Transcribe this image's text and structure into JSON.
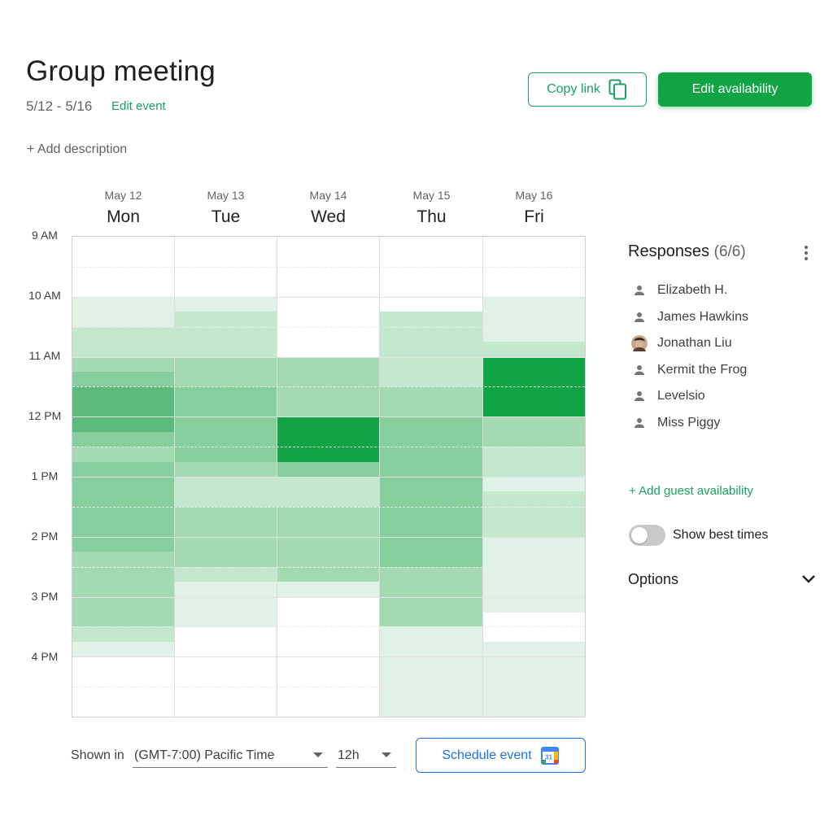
{
  "event": {
    "title": "Group meeting",
    "dates": "5/12 - 5/16",
    "edit_event": "Edit event",
    "add_description": "+ Add description"
  },
  "toolbar": {
    "copy_link": "Copy link",
    "edit_availability": "Edit availability"
  },
  "days": [
    {
      "date": "May 12",
      "dow": "Mon"
    },
    {
      "date": "May 13",
      "dow": "Tue"
    },
    {
      "date": "May 14",
      "dow": "Wed"
    },
    {
      "date": "May 15",
      "dow": "Thu"
    },
    {
      "date": "May 16",
      "dow": "Fri"
    }
  ],
  "times": [
    "9 AM",
    "10 AM",
    "11 AM",
    "12 PM",
    "1 PM",
    "2 PM",
    "3 PM",
    "4 PM"
  ],
  "availability": {
    "total_responses": 6,
    "slot_minutes": 15,
    "colors": [
      "#ffffff",
      "#e0f2e5",
      "#c3e8cd",
      "#a3dab2",
      "#86ce9b",
      "#5cba7a",
      "#10a445"
    ],
    "counts_by_day": [
      [
        0,
        0,
        0,
        0,
        1,
        1,
        2,
        2,
        3,
        4,
        5,
        5,
        5,
        4,
        3,
        4,
        4,
        4,
        4,
        4,
        4,
        3,
        3,
        3,
        3,
        3,
        2,
        1,
        0,
        0,
        0,
        0
      ],
      [
        0,
        0,
        0,
        0,
        1,
        2,
        2,
        2,
        3,
        3,
        4,
        4,
        4,
        4,
        4,
        3,
        2,
        2,
        3,
        3,
        3,
        3,
        2,
        1,
        1,
        1,
        0,
        0,
        0,
        0,
        0,
        0
      ],
      [
        0,
        0,
        0,
        0,
        0,
        0,
        0,
        0,
        3,
        3,
        3,
        3,
        6,
        6,
        6,
        4,
        2,
        2,
        3,
        3,
        3,
        3,
        3,
        1,
        0,
        0,
        0,
        0,
        0,
        0,
        0,
        0
      ],
      [
        0,
        0,
        0,
        0,
        0,
        2,
        2,
        2,
        2,
        2,
        3,
        3,
        4,
        4,
        4,
        4,
        4,
        4,
        4,
        4,
        4,
        4,
        3,
        3,
        3,
        3,
        1,
        1,
        1,
        1,
        1,
        1
      ],
      [
        0,
        0,
        0,
        0,
        1,
        1,
        1,
        2,
        6,
        6,
        6,
        6,
        3,
        3,
        2,
        2,
        1,
        2,
        2,
        2,
        1,
        1,
        1,
        1,
        1,
        0,
        0,
        1,
        1,
        1,
        1,
        1
      ]
    ]
  },
  "footer": {
    "shown_in": "Shown in",
    "timezone": "(GMT-7:00) Pacific Time",
    "format": "12h",
    "schedule_event": "Schedule event",
    "calendar_day": "31"
  },
  "responses": {
    "title": "Responses",
    "count": "(6/6)",
    "people": [
      {
        "name": "Elizabeth H.",
        "icon": "person-icon"
      },
      {
        "name": "James Hawkins",
        "icon": "person-icon"
      },
      {
        "name": "Jonathan Liu",
        "icon": "avatar-photo"
      },
      {
        "name": "Kermit the Frog",
        "icon": "person-icon"
      },
      {
        "name": "Levelsio",
        "icon": "person-icon"
      },
      {
        "name": "Miss Piggy",
        "icon": "person-icon"
      }
    ],
    "add_guest": "+ Add guest availability",
    "show_best_times": "Show best times",
    "show_best_times_on": false,
    "options": "Options"
  }
}
